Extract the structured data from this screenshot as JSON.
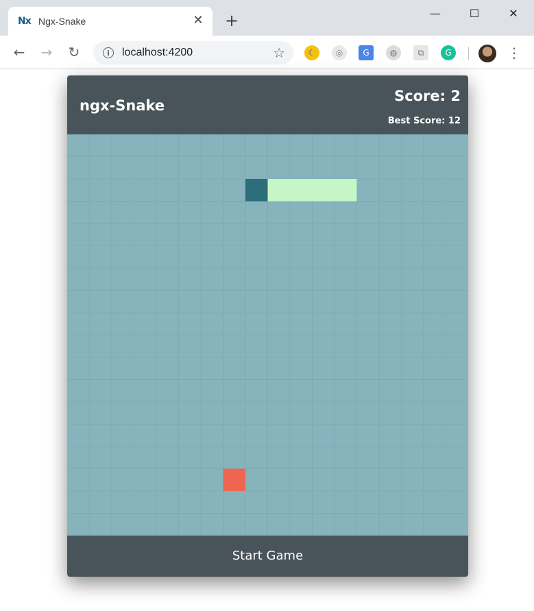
{
  "browser": {
    "tab_title": "Ngx-Snake",
    "favicon_text": "Nx",
    "url": "localhost:4200",
    "icons": [
      "back-icon",
      "forward-icon",
      "reload-icon",
      "info-icon",
      "star-icon",
      "extension-icon",
      "menu-icon"
    ]
  },
  "game": {
    "title": "ngx-Snake",
    "score_label": "Score: 2",
    "best_label": "Best Score: 12",
    "start_label": "Start Game",
    "grid": {
      "cols": 18,
      "rows": 18
    },
    "snake": {
      "head": [
        8,
        2
      ],
      "body": [
        [
          9,
          2
        ],
        [
          10,
          2
        ],
        [
          11,
          2
        ],
        [
          12,
          2
        ]
      ]
    },
    "fruit": [
      7,
      15
    ],
    "colors": {
      "board": "#87b4bc",
      "grid_line": "#7daab3",
      "snake_head": "#2d6e7a",
      "snake_body": "#c6f5c6",
      "fruit": "#ef6650",
      "panel": "#485459"
    }
  }
}
